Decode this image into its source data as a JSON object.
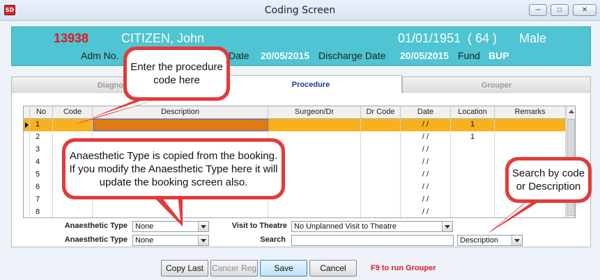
{
  "window": {
    "title": "Coding Screen",
    "app_icon": "SD"
  },
  "patient": {
    "adm_no": "13938",
    "name": "CITIZEN,  John",
    "dob": "01/01/1951",
    "age": "( 64 )",
    "sex": "Male",
    "adm_no_label": "Adm No.",
    "admit_date_label": "Date",
    "admit_date": "20/05/2015",
    "discharge_label": "Discharge Date",
    "discharge_date": "20/05/2015",
    "fund_label": "Fund",
    "fund": "BUP"
  },
  "tabs": [
    {
      "label": "Diagnosis",
      "active": false
    },
    {
      "label": "Procedure",
      "active": true
    },
    {
      "label": "Grouper",
      "active": false
    }
  ],
  "grid": {
    "columns": [
      "No",
      "Code",
      "Description",
      "Surgeon/Dr",
      "Dr Code",
      "Date",
      "Location",
      "Remarks"
    ],
    "rows": [
      {
        "no": "1",
        "date": "/ /",
        "location": "1",
        "selected": true
      },
      {
        "no": "2",
        "date": "/ /",
        "location": "1"
      },
      {
        "no": "3",
        "date": "/ /",
        "location": ""
      },
      {
        "no": "4",
        "date": "/ /",
        "location": ""
      },
      {
        "no": "5",
        "date": "/ /",
        "location": ""
      },
      {
        "no": "6",
        "date": "/ /",
        "location": ""
      },
      {
        "no": "7",
        "date": "/ /",
        "location": ""
      },
      {
        "no": "8",
        "date": "/ /",
        "location": ""
      }
    ]
  },
  "form": {
    "anaesthetic_label_1": "Anaesthetic Type",
    "anaesthetic_value_1": "None",
    "anaesthetic_label_2": "Anaesthetic Type",
    "anaesthetic_value_2": "None",
    "visit_label": "Visit to Theatre",
    "visit_value": "No Unplanned Visit to Theatre",
    "search_label": "Search",
    "search_value": "",
    "search_mode": "Description"
  },
  "buttons": {
    "copy_last": "Copy Last",
    "cancer_reg": "Cancer Reg",
    "save": "Save",
    "cancel": "Cancel"
  },
  "hint": "F9 to run Grouper",
  "callouts": {
    "procedure_code": "Enter the procedure code here",
    "anaesthetic": "Anaesthetic Type is copied from the booking. If you modify the Anaesthetic Type here it will update the booking screen also.",
    "search": "Search by code or Description"
  },
  "colors": {
    "header_bg": "#4fc4d2",
    "adm_no": "#e8141c",
    "selected_row": "#f5b21e",
    "selected_cell": "#e07b14",
    "callout_border": "#e43a3a",
    "active_tab_text": "#1a3c9a"
  }
}
